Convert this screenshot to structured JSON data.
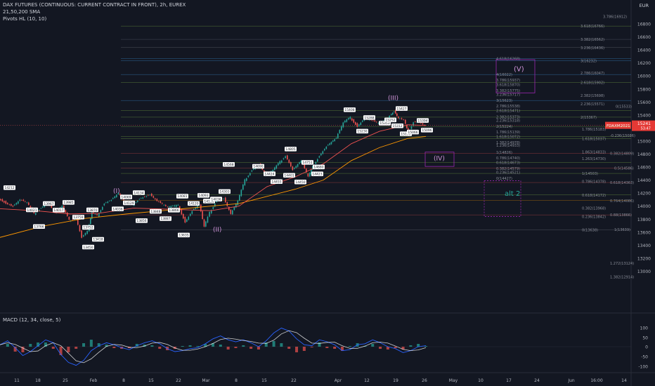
{
  "header": {
    "title": "DAX FUTURES (CONTINUOUS: CURRENT CONTRACT IN FRONT), 2h, EUREX",
    "sma": "21,50,200 SMA",
    "pivots": "Pivots HL (10, 10)"
  },
  "macd": {
    "label": "MACD (12, 34, close, 5)",
    "axis": [
      "100",
      "50",
      "0",
      "-50",
      "-100"
    ],
    "values": [
      0.1,
      0.3,
      -0.05,
      -0.45,
      -0.25,
      0.05,
      0.35,
      0.2,
      -0.4,
      -0.8,
      -0.95,
      -0.7,
      -0.2,
      0.05,
      0.2,
      0.1,
      -0.05,
      -0.15,
      0.05,
      0.2,
      0.3,
      0.15,
      -0.1,
      -0.25,
      -0.2,
      -0.1,
      -0.05,
      0.15,
      0.4,
      0.55,
      0.35,
      0.25,
      0.35,
      0.2,
      0.0,
      0.3,
      0.7,
      0.95,
      0.8,
      0.4,
      0.1,
      0.05,
      0.35,
      0.25,
      0.1,
      -0.2,
      -0.15,
      0.1,
      0.15,
      0.35,
      0.2,
      0.0,
      -0.1,
      -0.3,
      -0.2,
      0.0,
      0.05
    ]
  },
  "price_axis": {
    "currency": "EUR",
    "ticks": [
      "16800",
      "16600",
      "16400",
      "16200",
      "16000",
      "15800",
      "15600",
      "15400",
      "15200",
      "15000",
      "14800",
      "14600",
      "14400",
      "14200",
      "14000",
      "13800",
      "13600",
      "13400",
      "13200",
      "13000"
    ]
  },
  "last_price": {
    "symbol": "FDAXM2021",
    "value": "15241",
    "sub": "53:47"
  },
  "time_axis": [
    "11",
    "18",
    "25",
    "Feb",
    "8",
    "15",
    "22",
    "Mar",
    "8",
    "15",
    "22",
    "Apr",
    "12",
    "19",
    "26",
    "May",
    "10",
    "17",
    "24",
    "Jun",
    "16:00",
    "14"
  ],
  "fib_labels": {
    "lower": [
      "1.786(15183)",
      "-0.236(15086)",
      "1.618(15037)",
      "1.863(14833)",
      "0.382(14809)",
      "1.263(14730)",
      "0.5(14586)",
      "1(14503)",
      "0.786(14378)",
      "0.618(14363)",
      "0.618(14172)",
      "0.764(14086)",
      "0.382(13968)",
      "0.88(13866)",
      "0.236(13842)",
      "0(13638)",
      "1(13639)",
      "1.272(13124)",
      "1.382(12914)"
    ],
    "upper": [
      "3.786(16912)",
      "3.618(16766)",
      "3.382(16562)",
      "3.236(16436)",
      "4.618(16268)",
      "3(16232)",
      "2.786(16047)",
      "4(16022)",
      "3.786(15937)",
      "3.618(15870)",
      "2.618(15902)",
      "3.382(15775)",
      "3.236(15717)",
      "2.382(15698)",
      "3(15623)",
      "2.236(15571)",
      "0(15533)",
      "2.786(15538)",
      "2.618(15471)",
      "2(15367)",
      "2.382(15373)",
      "2.236(15318)",
      "2(15224)",
      "1.786(15139)",
      "1.618(15072)",
      "1.382(14978)",
      "1.236(14933)",
      "1(14826)",
      "0.786(14740)",
      "0.618(14673)",
      "0.382(14579)",
      "0.236(14521)",
      "0(14427)"
    ]
  },
  "wave_labels": [
    "(I)",
    "(II)",
    "(III)",
    "(IV)",
    "(V)",
    "alt 2"
  ],
  "pivot_labels": [
    "14212",
    "14021",
    "13967",
    "14017",
    "13985",
    "13766",
    "13759",
    "13752",
    "13870",
    "13450",
    "13418",
    "14036",
    "14069",
    "14129",
    "14134",
    "13856",
    "13848",
    "13887",
    "13866",
    "13635",
    "14081",
    "14120",
    "14093",
    "14156",
    "14036",
    "14303",
    "14568",
    "14690",
    "14424",
    "14455",
    "14401",
    "14450",
    "14805",
    "14751",
    "14423",
    "14680",
    "15408",
    "15230",
    "15288",
    "15353",
    "15252",
    "15312",
    "15427",
    "15190",
    "15066",
    "15394",
    "15096"
  ],
  "colors": {
    "background": "#131722",
    "up_candle": "#26a69a",
    "down_candle": "#ef5350",
    "sma_fast": "#ef5350",
    "sma_slow": "#ff9800",
    "macd_line": "#2962ff",
    "signal_line": "#ffffff",
    "fib_box": "#9c27b0",
    "last_price_bg": "#e53935"
  }
}
